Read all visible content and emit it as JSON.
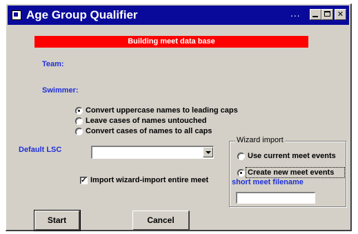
{
  "window": {
    "title": "Age Group Qualifier",
    "title_dots": "...",
    "controls": {
      "minimize_icon": "minimize-icon",
      "maximize_icon": "maximize-icon",
      "close_glyph": "✕"
    }
  },
  "status": {
    "message": "Building meet data base",
    "background_color": "#ff0000"
  },
  "labels": {
    "team": "Team:",
    "swimmer": "Swimmer:",
    "default_lsc": "Default LSC"
  },
  "name_case_options": [
    {
      "label": "Convert uppercase names to leading caps",
      "selected": true
    },
    {
      "label": "Leave cases of names untouched",
      "selected": false
    },
    {
      "label": "Convert cases of names to all caps",
      "selected": false
    }
  ],
  "default_lsc_select": {
    "value": ""
  },
  "import_checkbox": {
    "label": "Import wizard-import entire meet",
    "checked": true,
    "check_glyph": "✓"
  },
  "wizard_import": {
    "title": "Wizard import",
    "options": [
      {
        "label": "Use current meet events",
        "selected": false
      },
      {
        "label": "Create new meet events",
        "selected": true
      }
    ],
    "filename_label": "short meet filename",
    "filename_value": ""
  },
  "buttons": {
    "start": "Start",
    "cancel": "Cancel"
  },
  "colors": {
    "title_bar": "#0a0a9a",
    "window_face": "#d4d0c8",
    "label_blue": "#1f2fd6"
  }
}
